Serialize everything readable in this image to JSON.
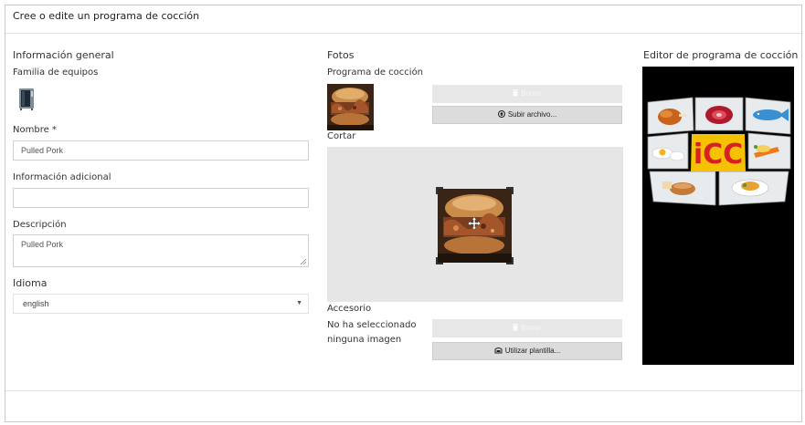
{
  "header": {
    "title": "Cree o edite un programa de cocción"
  },
  "general": {
    "title": "Información general",
    "family_label": "Familia de equipos",
    "name_label": "Nombre *",
    "name_value": "Pulled Pork",
    "additional_label": "Información adicional",
    "additional_value": "",
    "description_label": "Descripción",
    "description_value": "Pulled Pork",
    "language_label": "Idioma",
    "language_value": "english"
  },
  "photos": {
    "title": "Fotos",
    "program_label": "Programa de cocción",
    "delete_label": "Borrar",
    "upload_label": "Subir archivo...",
    "crop_label": "Cortar",
    "accessory_label": "Accesorio",
    "no_image_text_1": "No ha seleccionado",
    "no_image_text_2": "ninguna imagen",
    "accessory_delete_label": "Borrar",
    "template_label": "Utilizar plantilla..."
  },
  "editor": {
    "title": "Editor de programa de cocción",
    "logo_text": "iCC"
  },
  "colors": {
    "editor_bg": "#000000",
    "logo_red": "#d91f26",
    "logo_yellow": "#f5c100",
    "button_gray": "#dcdcdc"
  },
  "icons": [
    "combi-oven-icon",
    "upload-icon",
    "trash-icon",
    "move-icon",
    "template-icon",
    "chevron-down-icon"
  ]
}
